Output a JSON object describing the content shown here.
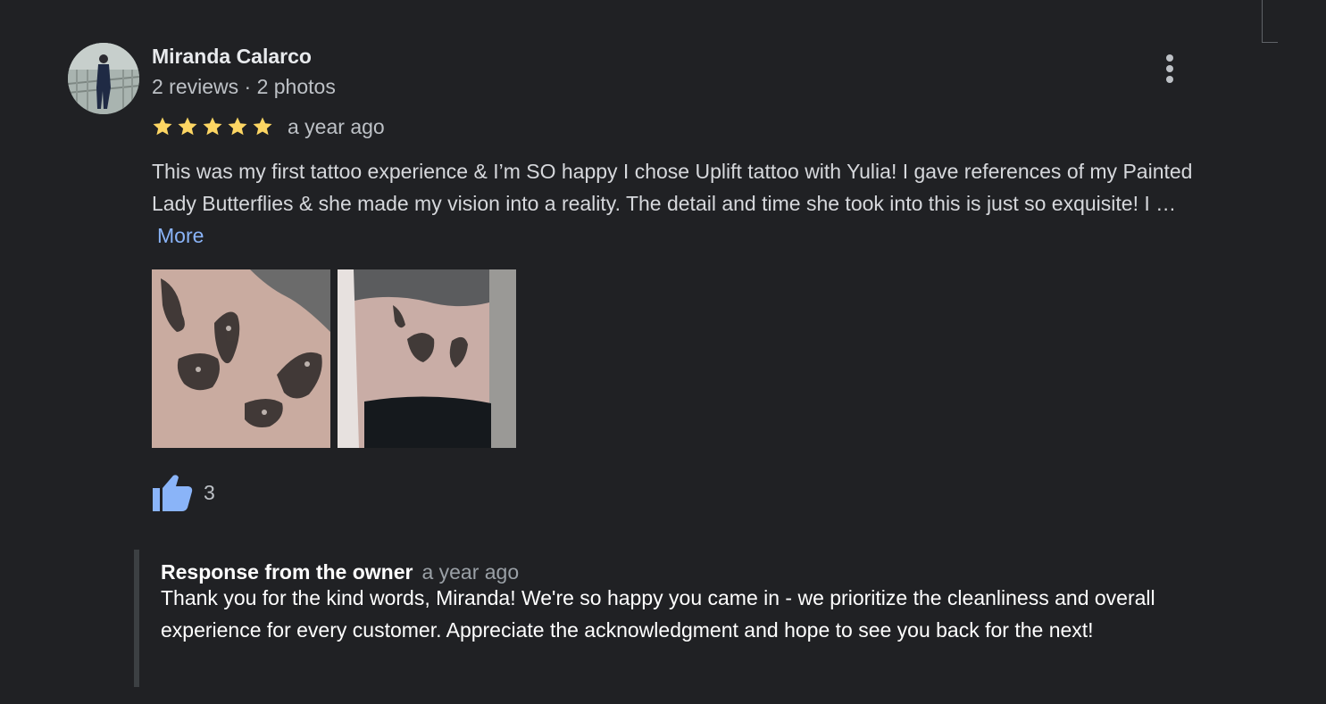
{
  "review": {
    "author": {
      "name": "Miranda Calarco",
      "meta": "2 reviews · 2 photos",
      "avatar_icon": "profile-photo"
    },
    "rating": 5,
    "max_rating": 5,
    "star_color": "#fdd663",
    "time_ago": "a year ago",
    "text": "This was my first tattoo experience & I’m SO happy I chose Uplift tattoo with Yulia! I gave references of my Painted Lady Butterflies & she made my vision into a reality. The detail and time she took into this is just so exquisite! I …",
    "more_label": "More",
    "photos": [
      {
        "subject": "butterfly tattoo close-up"
      },
      {
        "subject": "butterfly tattoo on side torso"
      }
    ],
    "likes": {
      "icon": "thumbs-up-icon",
      "count": "3",
      "color": "#8ab4f8"
    },
    "menu_icon": "more-vert-icon"
  },
  "owner_response": {
    "title": "Response from the owner",
    "time_ago": "a year ago",
    "text": "Thank you for the kind words, Miranda! We're so happy you came in - we prioritize the cleanliness and overall experience for every customer. Appreciate the acknowledgment and hope to see you back for the next!"
  },
  "colors": {
    "background": "#202124",
    "link": "#8ab4f8",
    "secondary_text": "#bdc1c6"
  }
}
